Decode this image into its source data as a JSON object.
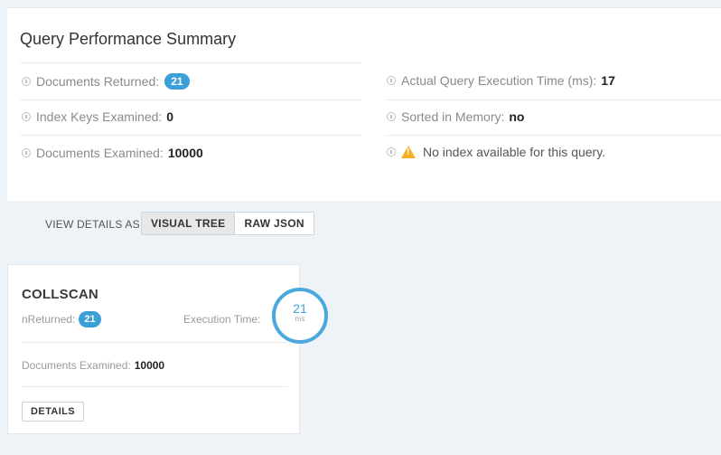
{
  "summary": {
    "title": "Query Performance Summary",
    "docs_returned_label": "Documents Returned:",
    "docs_returned_value": "21",
    "index_keys_label": "Index Keys Examined:",
    "index_keys_value": "0",
    "docs_examined_label": "Documents Examined:",
    "docs_examined_value": "10000",
    "exec_time_label": "Actual Query Execution Time (ms):",
    "exec_time_value": "17",
    "sorted_label": "Sorted in Memory:",
    "sorted_value": "no",
    "warning_text": "No index available for this query."
  },
  "view": {
    "label": "VIEW DETAILS AS",
    "visual_tree": "VISUAL TREE",
    "raw_json": "RAW JSON"
  },
  "stage": {
    "title": "COLLSCAN",
    "nreturned_label": "nReturned:",
    "nreturned_value": "21",
    "exec_time_label": "Execution Time:",
    "exec_time_value": "21",
    "exec_time_unit": "ms",
    "docs_examined_label": "Documents Examined:",
    "docs_examined_value": "10000",
    "details_button": "DETAILS"
  },
  "colors": {
    "accent": "#3b9fd8",
    "warning": "#f2b322",
    "background": "#eef3f7"
  }
}
